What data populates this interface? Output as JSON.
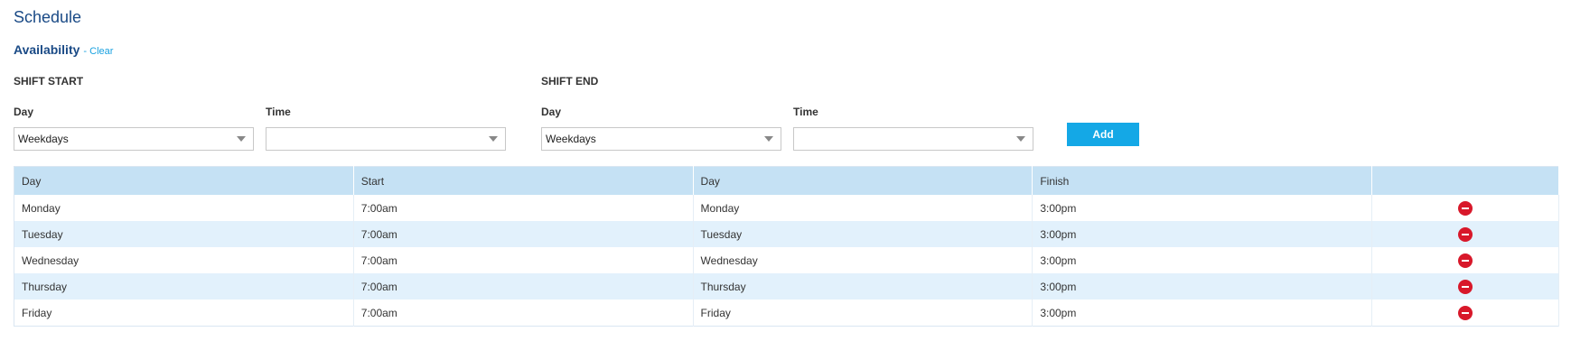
{
  "page": {
    "title": "Schedule"
  },
  "availability": {
    "label": "Availability",
    "clear_label": "- Clear"
  },
  "shift_start": {
    "heading": "SHIFT START",
    "day_label": "Day",
    "day_value": "Weekdays",
    "time_label": "Time",
    "time_value": ""
  },
  "shift_end": {
    "heading": "SHIFT END",
    "day_label": "Day",
    "day_value": "Weekdays",
    "time_label": "Time",
    "time_value": ""
  },
  "add_label": "Add",
  "table": {
    "headers": [
      "Day",
      "Start",
      "Day",
      "Finish",
      ""
    ],
    "rows": [
      [
        "Monday",
        "7:00am",
        "Monday",
        "3:00pm"
      ],
      [
        "Tuesday",
        "7:00am",
        "Tuesday",
        "3:00pm"
      ],
      [
        "Wednesday",
        "7:00am",
        "Wednesday",
        "3:00pm"
      ],
      [
        "Thursday",
        "7:00am",
        "Thursday",
        "3:00pm"
      ],
      [
        "Friday",
        "7:00am",
        "Friday",
        "3:00pm"
      ]
    ]
  },
  "colors": {
    "accent": "#14a8e6",
    "title": "#1a4a86",
    "header_bg": "#c5e1f4",
    "alt_row": "#e2f1fc",
    "remove": "#d8182a"
  },
  "icons": {
    "remove": "remove-icon",
    "dropdown": "chevron-down-icon"
  }
}
